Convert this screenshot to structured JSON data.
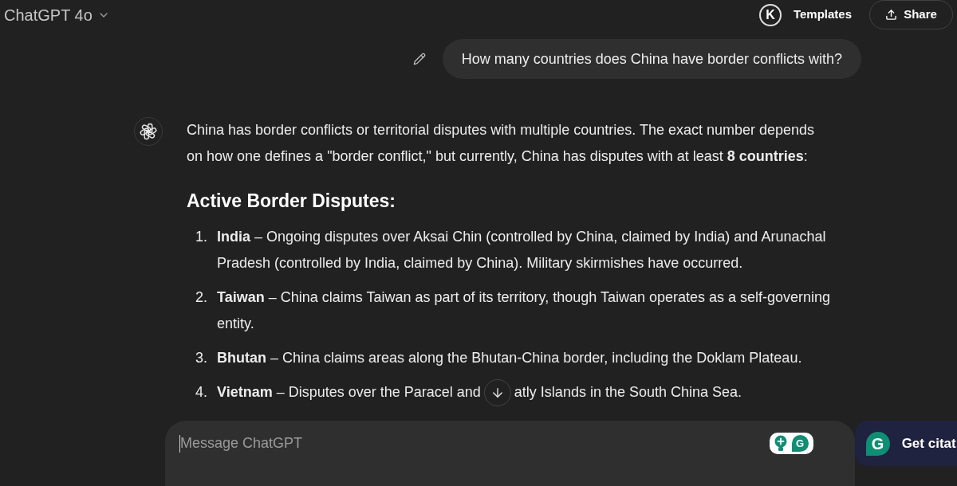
{
  "header": {
    "model": "ChatGPT 4o",
    "extension_logo": "K",
    "templates": "Templates",
    "share": "Share"
  },
  "user_message": {
    "text": "How many countries does China have border conflicts with?"
  },
  "assistant_message": {
    "intro": "China has border conflicts or territorial disputes with multiple countries. The exact number depends on how one defines a \"border conflict,\" but currently, China has disputes with at least **8 countries**:",
    "heading": "Active Border Disputes:",
    "items": [
      {
        "number": "1.",
        "text": "**India** – Ongoing disputes over Aksai Chin (controlled by China, claimed by India) and Arunachal Pradesh (controlled by India, claimed by China). Military skirmishes have occurred."
      },
      {
        "number": "2.",
        "text": "**Taiwan** – China claims Taiwan as part of its territory, though Taiwan operates as a self-governing entity."
      },
      {
        "number": "3.",
        "text": "**Bhutan** – China claims areas along the Bhutan-China border, including the Doklam Plateau."
      },
      {
        "number": "4.",
        "text": "**Vietnam** – Disputes over the Paracel and",
        "text_after_cover": "atly Islands in the South China Sea."
      }
    ]
  },
  "composer": {
    "placeholder": "Message ChatGPT",
    "widget_logo": "G"
  },
  "citation_panel": {
    "logo": "G",
    "label": "Get citat"
  }
}
